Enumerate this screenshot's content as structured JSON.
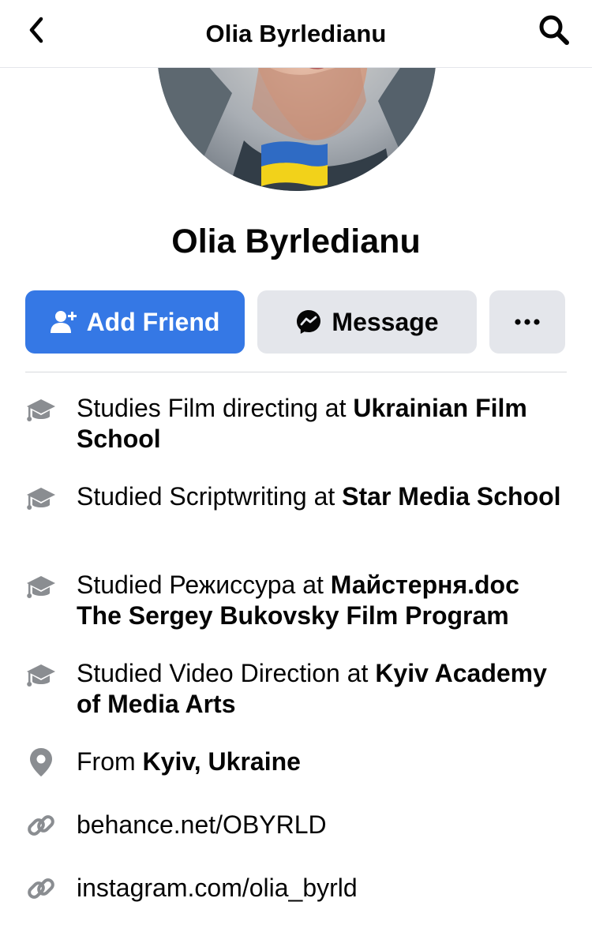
{
  "header": {
    "title": "Olia Byrledianu",
    "back_icon": "chevron-left-icon",
    "search_icon": "search-icon"
  },
  "profile": {
    "name": "Olia Byrledianu",
    "flag": "ukraine-flag"
  },
  "actions": {
    "add_friend": "Add Friend",
    "message": "Message",
    "more": "more-dots-icon"
  },
  "info": [
    {
      "icon": "graduation-cap-icon",
      "prefix": "Studies Film directing at ",
      "place": "Ukrainian Film School"
    },
    {
      "icon": "graduation-cap-icon",
      "prefix": "Studied Scriptwriting at ",
      "place": "Star Media School"
    },
    {
      "icon": "graduation-cap-icon",
      "prefix": "Studied Режиссура at ",
      "place": "Майстерня.doc The Sergey Bukovsky Film Program"
    },
    {
      "icon": "graduation-cap-icon",
      "prefix": "Studied Video Direction at ",
      "place": "Kyiv Academy of Media Arts"
    },
    {
      "icon": "location-pin-icon",
      "prefix": "From ",
      "place": "Kyiv, Ukraine"
    },
    {
      "icon": "link-icon",
      "prefix": "behance.net/OBYRLD",
      "place": ""
    },
    {
      "icon": "link-icon",
      "prefix": "instagram.com/olia_byrld",
      "place": ""
    }
  ],
  "colors": {
    "accent": "#3578e5",
    "secondary_button": "#e4e6eb",
    "icon_gray": "#8a8d91",
    "flag_blue": "#2f6bc4",
    "flag_yellow": "#f2d21a"
  }
}
